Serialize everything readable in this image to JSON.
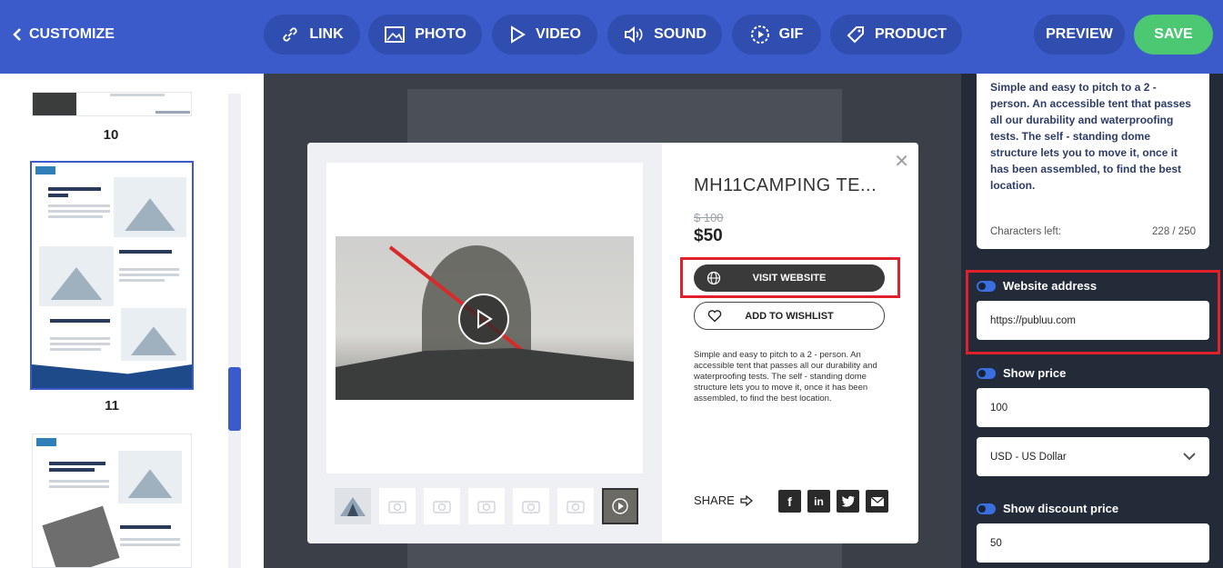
{
  "topbar": {
    "back_label": "CUSTOMIZE",
    "tools": [
      "LINK",
      "PHOTO",
      "VIDEO",
      "SOUND",
      "GIF",
      "PRODUCT"
    ],
    "preview_label": "PREVIEW",
    "save_label": "SAVE",
    "colors": {
      "bar": "#3a5bc9",
      "save": "#4cc873"
    }
  },
  "pages": [
    {
      "number": "10"
    },
    {
      "number": "11"
    }
  ],
  "modal": {
    "title": "MH11CAMPING TE...",
    "old_price": "$ 100",
    "price": "$50",
    "visit_label": "VISIT WEBSITE",
    "wishlist_label": "ADD TO WISHLIST",
    "description": "Simple and easy to pitch to a 2 - person. An accessible tent that passes all our durability and waterproofing tests. The self - standing dome structure lets you to move it, once it has been assembled, to find the best location.",
    "share_label": "SHARE",
    "social": [
      "facebook-icon",
      "linkedin-icon",
      "twitter-icon",
      "email-icon"
    ]
  },
  "settings": {
    "description": "Simple and easy to pitch to a 2 - person. An accessible tent that passes all our durability and waterproofing tests. The self - standing dome structure lets you to move it, once it has been assembled, to find the best location.",
    "chars_left_label": "Characters left:",
    "chars_count": "228 / 250",
    "website_label": "Website address",
    "website_value": "https://publuu.com",
    "show_price_label": "Show price",
    "price_value": "100",
    "currency_value": "USD - US Dollar",
    "show_discount_label": "Show discount price",
    "discount_value": "50"
  }
}
